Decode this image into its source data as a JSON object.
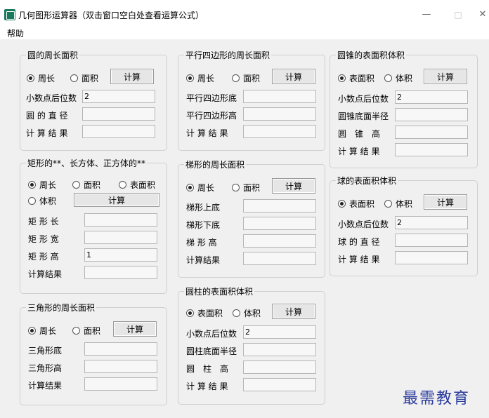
{
  "window": {
    "title": "几何图形运算器（双击窗口空白处查看运算公式）",
    "minimize": "—",
    "maximize": "□",
    "close": "✕"
  },
  "menu": {
    "help": "帮助"
  },
  "circle": {
    "title": "圆的周长面积",
    "radio1": "周长",
    "radio2": "面积",
    "button": "计算",
    "label_decimals": "小数点后位数",
    "decimals_value": "2",
    "label_diameter": "圆 的 直 径",
    "label_result": "计 算 结 果",
    "diameter_value": "",
    "result_value": ""
  },
  "rect": {
    "title": "矩形的**、长方体、正方体的**",
    "radio1": "周长",
    "radio2": "面积",
    "radio3": "表面积",
    "radio4": "体积",
    "button": "计算",
    "label_length": "矩 形 长",
    "label_width": "矩 形 宽",
    "label_height": "矩 形 高",
    "height_value": "1",
    "label_result": "计算结果"
  },
  "triangle": {
    "title": "三角形的周长面积",
    "radio1": "周长",
    "radio2": "面积",
    "button": "计算",
    "label_base": "三角形底",
    "label_height": "三角形高",
    "label_result": "计算结果"
  },
  "para": {
    "title": "平行四边形的周长面积",
    "radio1": "周长",
    "radio2": "面积",
    "button": "计算",
    "label_base": "平行四边形底",
    "label_height": "平行四边形高",
    "label_result": "计 算 结 果"
  },
  "trap": {
    "title": "梯形的周长面积",
    "radio1": "周长",
    "radio2": "面积",
    "button": "计算",
    "label_top": "梯形上底",
    "label_bottom": "梯形下底",
    "label_height": "梯 形 高",
    "label_result": "计算结果"
  },
  "cyl": {
    "title": "圆柱的表面积体积",
    "radio1": "表面积",
    "radio2": "体积",
    "button": "计算",
    "label_decimals": "小数点后位数",
    "decimals_value": "2",
    "label_radius": "圆柱底面半径",
    "label_height": "圆　柱　高",
    "label_result": "计 算 结 果"
  },
  "cone": {
    "title": "圆锥的表面积体积",
    "radio1": "表面积",
    "radio2": "体积",
    "button": "计算",
    "label_decimals": "小数点后位数",
    "decimals_value": "2",
    "label_radius": "圆锥底面半径",
    "label_height": "圆　锥　高",
    "label_result": "计 算 结 果"
  },
  "sphere": {
    "title": "球的表面积体积",
    "radio1": "表面积",
    "radio2": "体积",
    "button": "计算",
    "label_decimals": "小数点后位数",
    "decimals_value": "2",
    "label_diameter": "球 的 直 径",
    "label_result": "计 算 结 果"
  },
  "watermark": "最需教育"
}
